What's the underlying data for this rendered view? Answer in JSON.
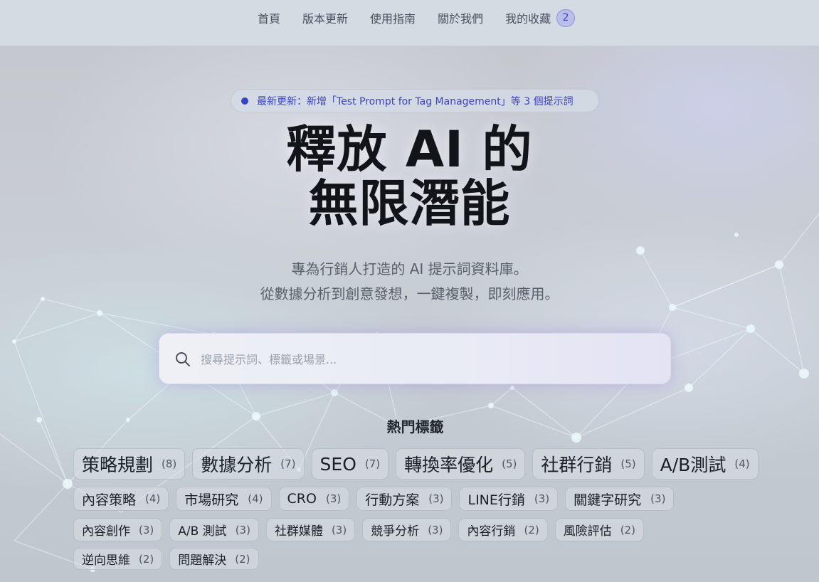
{
  "nav": {
    "links": [
      "首頁",
      "版本更新",
      "使用指南",
      "關於我們",
      "我的收藏"
    ],
    "favorites_count": "2"
  },
  "update_banner": {
    "text": "最新更新：新增「Test Prompt for Tag Management」等 3 個提示詞",
    "dot_color": "#3843c6"
  },
  "hero": {
    "title_line1": "釋放 AI 的",
    "title_line2": "無限潛能",
    "subtitle_line1": "專為行銷人打造的 AI 提示詞資料庫。",
    "subtitle_line2": "從數據分析到創意發想，一鍵複製，即刻應用。"
  },
  "search": {
    "placeholder": "搜尋提示詞、標籤或場景...",
    "icon": "search-icon"
  },
  "popular_tags": {
    "heading": "熱門標籤",
    "rows": [
      [
        {
          "name": "策略規劃",
          "count": "(8)"
        },
        {
          "name": "數據分析",
          "count": "(7)"
        },
        {
          "name": "SEO",
          "count": "(7)"
        },
        {
          "name": "轉換率優化",
          "count": "(5)"
        },
        {
          "name": "社群行銷",
          "count": "(5)"
        },
        {
          "name": "A/B測試",
          "count": "(4)"
        }
      ],
      [
        {
          "name": "內容策略",
          "count": "(4)"
        },
        {
          "name": "市場研究",
          "count": "(4)"
        },
        {
          "name": "CRO",
          "count": "(3)"
        },
        {
          "name": "行動方案",
          "count": "(3)"
        },
        {
          "name": "LINE行銷",
          "count": "(3)"
        },
        {
          "name": "關鍵字研究",
          "count": "(3)"
        }
      ],
      [
        {
          "name": "內容創作",
          "count": "(3)"
        },
        {
          "name": "A/B 測試",
          "count": "(3)"
        },
        {
          "name": "社群媒體",
          "count": "(3)"
        },
        {
          "name": "競爭分析",
          "count": "(3)"
        },
        {
          "name": "內容行銷",
          "count": "(2)"
        },
        {
          "name": "風險評估",
          "count": "(2)"
        }
      ],
      [
        {
          "name": "逆向思維",
          "count": "(2)"
        },
        {
          "name": "問題解決",
          "count": "(2)"
        }
      ]
    ]
  },
  "colors": {
    "accent": "#3843c6",
    "badge_bg": "#b9bfe8"
  }
}
